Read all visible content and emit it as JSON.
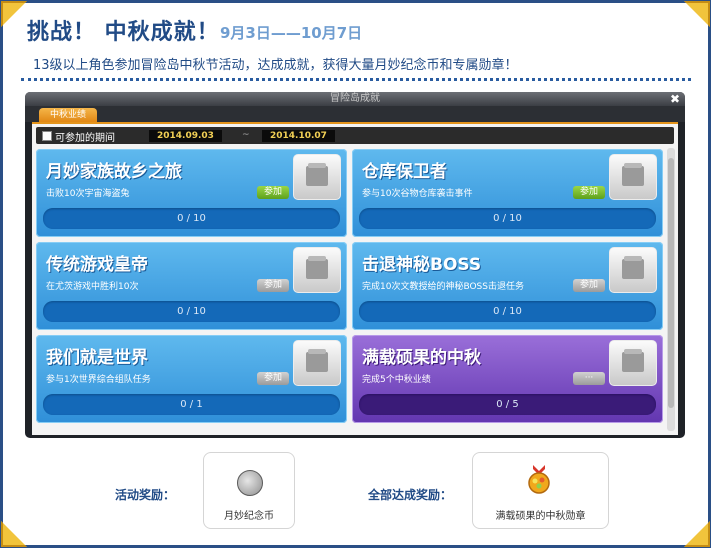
{
  "header": {
    "title": "挑战！ 中秋成就！",
    "date_range": "9月3日——10月7日",
    "description": "13级以上角色参加冒险岛中秋节活动，达成成就，获得大量月妙纪念币和专属勋章！"
  },
  "window": {
    "title": "冒险岛成就",
    "close_label": "✖",
    "tab_label": "中秋业绩",
    "period_label": "可参加的期间",
    "start_date": "2014.09.03",
    "separator": "~",
    "end_date": "2014.10.07"
  },
  "cards": [
    {
      "title": "月妙家族故乡之旅",
      "desc": "击败10次宇宙海盗兔",
      "button": "参加",
      "progress": "0 / 10"
    },
    {
      "title": "仓库保卫者",
      "desc": "参与10次谷物仓库袭击事件",
      "button": "参加",
      "progress": "0 / 10"
    },
    {
      "title": "传统游戏皇帝",
      "desc": "在尤茨游戏中胜利10次",
      "button": "参加",
      "progress": "0 / 10"
    },
    {
      "title": "击退神秘BOSS",
      "desc": "完成10次文教授给的神秘BOSS击退任务",
      "button": "参加",
      "progress": "0 / 10"
    },
    {
      "title": "我们就是世界",
      "desc": "参与1次世界综合组队任务",
      "button": "参加",
      "progress": "0 / 1"
    },
    {
      "title": "满载硕果的中秋",
      "desc": "完成5个中秋业绩",
      "button": "···",
      "progress": "0 / 5"
    }
  ],
  "rewards": {
    "activity_label": "活动奖励：",
    "activity_item": "月妙纪念币",
    "complete_label": "全部达成奖励：",
    "complete_item": "满载硕果的中秋勋章"
  }
}
